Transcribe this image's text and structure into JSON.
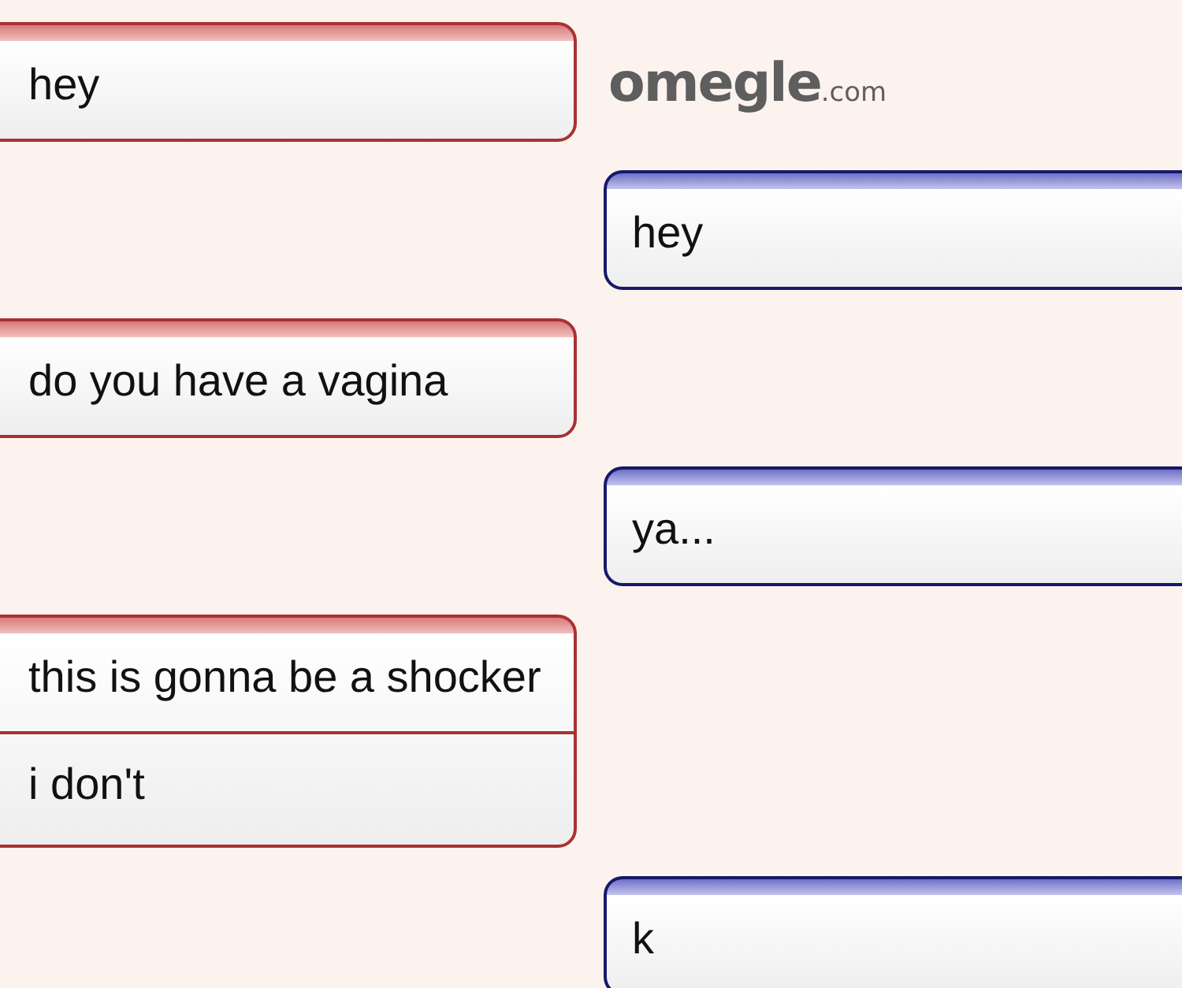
{
  "logo": {
    "name": "omegle",
    "suffix": ".com"
  },
  "messages": [
    {
      "kind": "stranger",
      "lines": [
        "hey"
      ]
    },
    {
      "kind": "you",
      "lines": [
        "hey"
      ]
    },
    {
      "kind": "stranger",
      "lines": [
        "do you have a vagina"
      ]
    },
    {
      "kind": "you",
      "lines": [
        "ya..."
      ]
    },
    {
      "kind": "stranger",
      "lines": [
        "this is gonna be a shocker",
        "i don't"
      ]
    },
    {
      "kind": "you",
      "lines": [
        "k"
      ]
    }
  ]
}
